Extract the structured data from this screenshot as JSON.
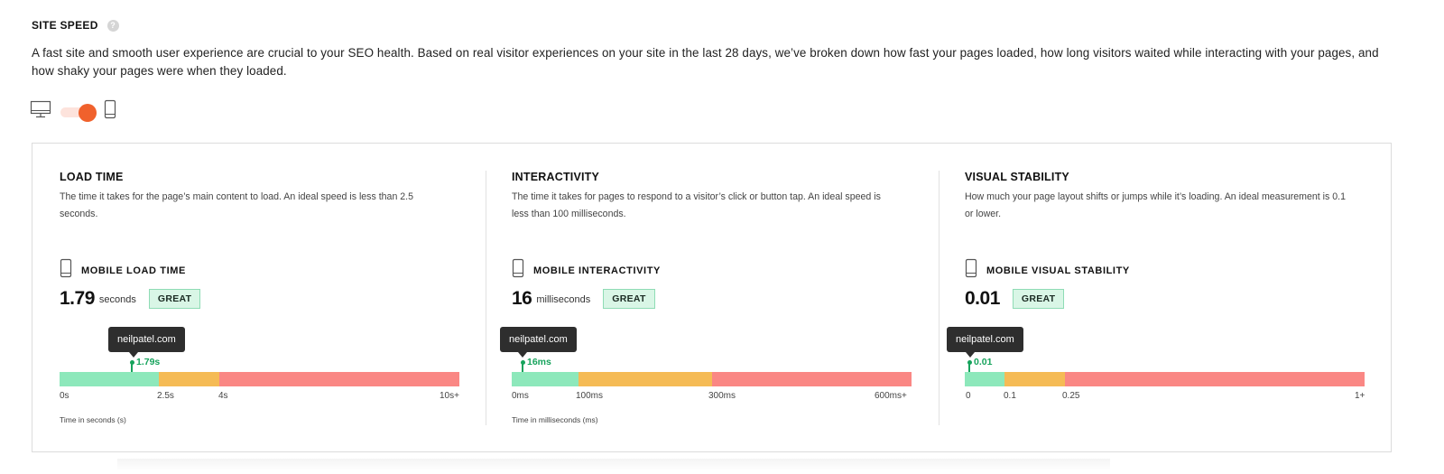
{
  "section": {
    "title": "SITE SPEED",
    "help_icon": "?",
    "description": "A fast site and smooth user experience are crucial to your SEO health. Based on real visitor experiences on your site in the last 28 days, we’ve broken down how fast your pages loaded, how long visitors waited while interacting with your pages, and how shaky your pages were when they loaded."
  },
  "device_toggle": {
    "left_icon": "desktop-icon",
    "right_icon": "mobile-icon",
    "selected": "mobile"
  },
  "colors": {
    "accent": "#f0612c",
    "good": "#8de8bb",
    "needs_improvement": "#f5bb55",
    "poor": "#fa8784",
    "marker": "#16a35c"
  },
  "metrics": [
    {
      "title": "LOAD TIME",
      "description": "The time it takes for the page’s main content to load. An ideal speed is less than 2.5 seconds.",
      "sub_label": "MOBILE LOAD TIME",
      "value": "1.79",
      "unit": "seconds",
      "badge": "GREAT",
      "site": "neilpatel.com",
      "marker_label": "1.79s",
      "marker_fraction": 0.185,
      "segments": {
        "good_end": 0.25,
        "mid_end": 0.4
      },
      "ticks": [
        "0s",
        "2.5s",
        "4s",
        "10s+"
      ],
      "axis_label": "Time in seconds (s)"
    },
    {
      "title": "INTERACTIVITY",
      "description": "The time it takes for pages to respond to a visitor’s click or button tap. An ideal speed is less than 100 milliseconds.",
      "sub_label": "MOBILE INTERACTIVITY",
      "value": "16",
      "unit": "milliseconds",
      "badge": "GREAT",
      "site": "neilpatel.com",
      "marker_label": "16ms",
      "marker_fraction": 0.027,
      "segments": {
        "good_end": 0.167,
        "mid_end": 0.5
      },
      "ticks": [
        "0ms",
        "100ms",
        "300ms",
        "600ms+"
      ],
      "axis_label": "Time in milliseconds (ms)"
    },
    {
      "title": "VISUAL STABILITY",
      "description": "How much your page layout shifts or jumps while it’s loading. An ideal measurement is 0.1 or lower.",
      "sub_label": "MOBILE VISUAL STABILITY",
      "value": "0.01",
      "unit": "",
      "badge": "GREAT",
      "site": "neilpatel.com",
      "marker_label": "0.01",
      "marker_fraction": 0.01,
      "segments": {
        "good_end": 0.1,
        "mid_end": 0.25
      },
      "ticks": [
        "0",
        "0.1",
        "0.25",
        "1+"
      ],
      "axis_label": ""
    }
  ]
}
